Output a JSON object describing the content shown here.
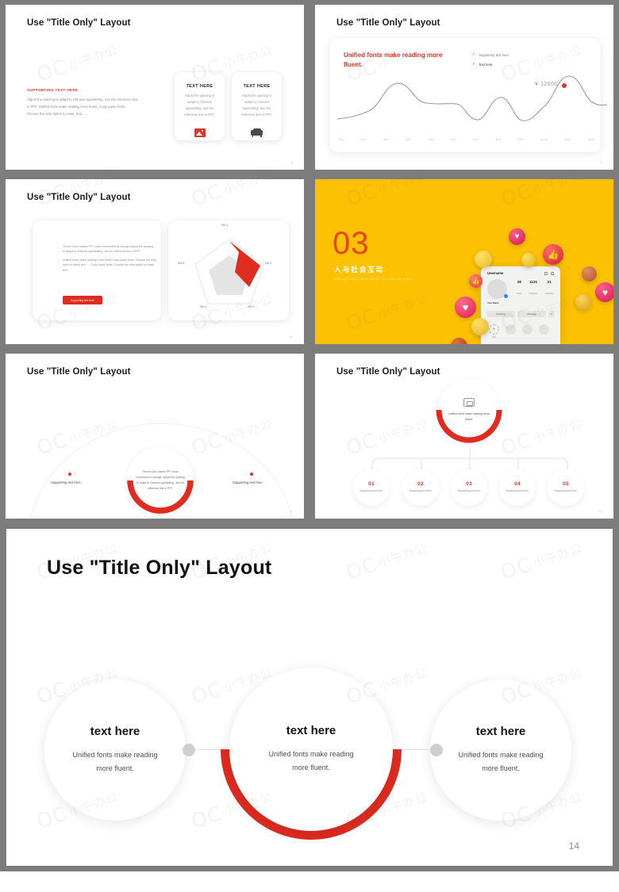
{
  "common": {
    "slide_title": "Use \"Title Only\" Layout"
  },
  "slides": [
    {
      "id": "slide-1",
      "title": "Use \"Title Only\" Layout",
      "page_number": "8",
      "supporting_heading": "SUPPORTING TEXT HERE",
      "body": "Adjust the spacing to adapt to Chinese typesetting, use the reference line in PPT. Unified fonts make reading more fluent. Copy paste fonts. Choose the only option to retain text......",
      "cards": [
        {
          "heading": "TEXT HERE",
          "text": "Adjust the spacing to adapt to Chinese typesetting, use the reference line in PPT.",
          "icon": "image-icon"
        },
        {
          "heading": "TEXT HERE",
          "text": "Adjust the spacing to adapt to Chinese typesetting, use the reference line in PPT.",
          "icon": "sofa-icon"
        }
      ]
    },
    {
      "id": "slide-2",
      "title": "Use \"Title Only\" Layout",
      "page_number": "9",
      "chart_heading": "Unified fonts make reading more fluent.",
      "legend": [
        "Supporting text here",
        "Text here"
      ],
      "value_label": "¥ 12600"
    },
    {
      "id": "slide-3",
      "title": "Use \"Title Only\" Layout",
      "page_number": "10",
      "bullets": [
        "Theme  color makes PPT more convenient to change.Adjust the spacing to adapt to Chinese typesetting, use the reference line in PPT.",
        "Unified fonts make reading more fluent.Copy paste fonts. Choose the only optio to retain text...... Copy paste  fonts. Choose the only option to retain text."
      ],
      "button_label": "Supporting text here",
      "radar_labels": [
        "NO.1",
        "NO.2",
        "NO.3",
        "NO.4",
        "NO.5"
      ]
    },
    {
      "id": "slide-4",
      "number": "03",
      "heading_cn": "人与社会互动",
      "heading_en": "When you copy & paste, choose \"keep text only\" option.",
      "phone": {
        "username": "Username",
        "profile_name": "Your Name",
        "stats": [
          {
            "value": "28",
            "label": "Posts"
          },
          {
            "value": "1131",
            "label": "Followers"
          },
          {
            "value": "21",
            "label": "Following"
          }
        ],
        "buttons": [
          "Following",
          "Message"
        ],
        "story_add": "New"
      }
    },
    {
      "id": "slide-5",
      "title": "Use \"Title Only\" Layout",
      "page_number": "11",
      "center_text": "Theme color makes PPT more convenient to change. Adjust the spacing to adapt to Chinese typesetting, use the reference line in PPT.",
      "nodes": [
        "Supporting text here.",
        "Supporting text here."
      ]
    },
    {
      "id": "slide-6",
      "title": "Use \"Title Only\" Layout",
      "page_number": "13",
      "top_text": "Unified fonts make reading more fluent.",
      "items": [
        {
          "num": "01",
          "text": "Supporting text here."
        },
        {
          "num": "02",
          "text": "Supporting text here."
        },
        {
          "num": "03",
          "text": "Supporting text here."
        },
        {
          "num": "04",
          "text": "Supporting text here."
        },
        {
          "num": "05",
          "text": "Supporting text here."
        }
      ]
    }
  ],
  "big_slide": {
    "title": "Use \"Title Only\" Layout",
    "page_number": "14",
    "circles": [
      {
        "heading": "text here",
        "text": "Unified fonts make reading more fluent."
      },
      {
        "heading": "text here",
        "text": "Unified fonts make reading more fluent."
      },
      {
        "heading": "text here",
        "text": "Unified fonts make reading more fluent."
      }
    ]
  },
  "watermark": {
    "mark": "OC",
    "text": "小牛办公"
  },
  "colors": {
    "accent_red": "#d8392b",
    "brand_yellow": "#fbc102",
    "orange": "#e8440f"
  }
}
